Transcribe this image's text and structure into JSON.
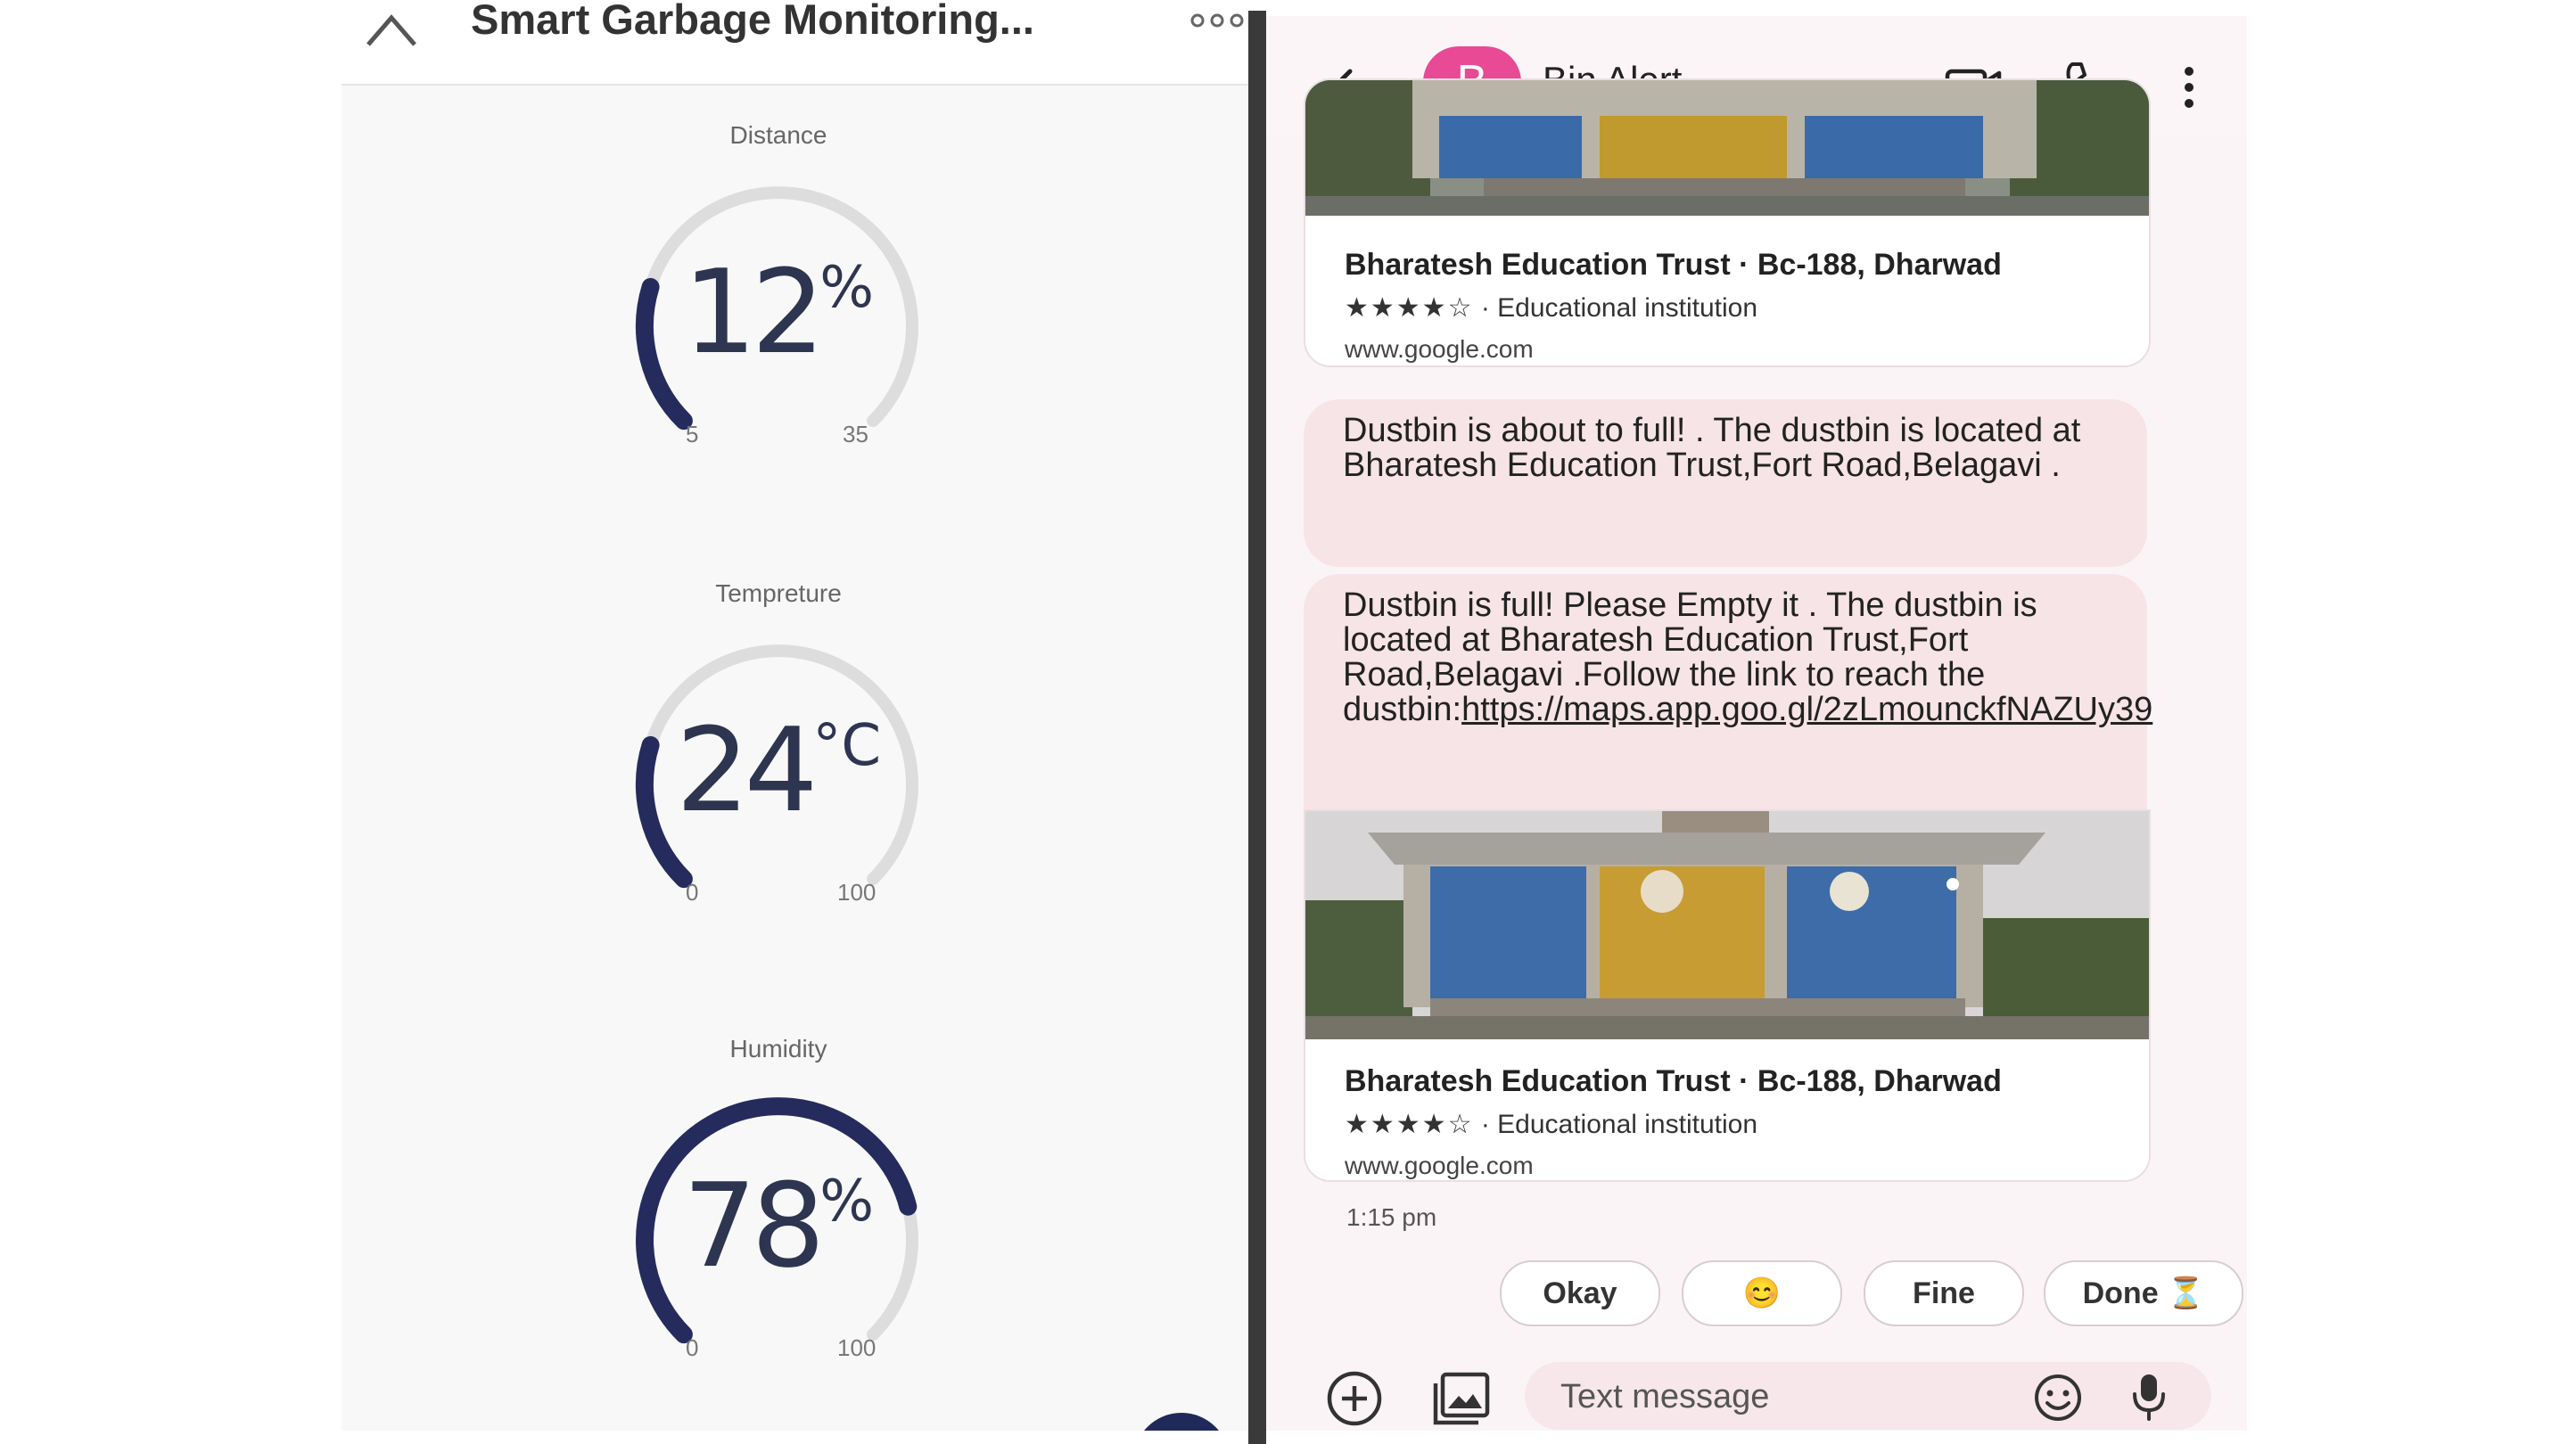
{
  "dashboard": {
    "title": "Smart Garbage Monitoring...",
    "icons": [
      "close-icon",
      "more-icon"
    ],
    "gauge_color": "#262b5e",
    "gauge_track_color": "#dddddd",
    "gauges": [
      {
        "label": "Distance",
        "value": "12",
        "unit": "%",
        "min": "5",
        "max": "35",
        "fraction": 0.23
      },
      {
        "label": "Tempreture",
        "value": "24",
        "unit": "°C",
        "min": "0",
        "max": "100",
        "fraction": 0.23
      },
      {
        "label": "Humidity",
        "value": "78",
        "unit": "%",
        "min": "0",
        "max": "100",
        "fraction": 0.78
      }
    ]
  },
  "messages": {
    "contact_initial": "B",
    "contact_name": "Bin Alert",
    "avatar_color": "#e84a96",
    "icons": [
      "back-arrow-icon",
      "video-call-icon",
      "phone-icon",
      "more-vert-icon"
    ],
    "cards": [
      {
        "title": "Bharatesh Education Trust · Bc-188, Dharwad",
        "stars": "★★★★☆",
        "category": " · Educational institution",
        "url": "www.google.com"
      },
      {
        "title": "Bharatesh Education Trust · Bc-188, Dharwad",
        "stars": "★★★★☆",
        "category": " · Educational institution",
        "url": "www.google.com"
      }
    ],
    "bubble1": "Dustbin is about to full!  . The dustbin is located at Bharatesh Education Trust,Fort Road,Belagavi .",
    "bubble2_text": "Dustbin is full! Please Empty it . The dustbin is located at Bharatesh Education Trust,Fort Road,Belagavi .Follow the link to reach the dustbin:",
    "bubble2_link": "https://maps.app.goo.gl/2zLmounckfNAZUy39",
    "timestamp": "1:15 pm",
    "smart_replies": [
      "Okay",
      "😊",
      "Fine",
      "Done ⏳"
    ],
    "input_placeholder": "Text message",
    "input_icons": [
      "add-icon",
      "gallery-icon",
      "emoji-icon",
      "mic-icon"
    ]
  }
}
